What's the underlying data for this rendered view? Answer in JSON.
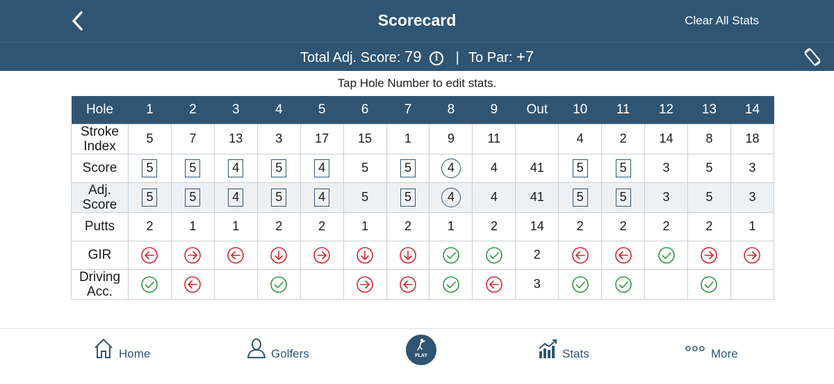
{
  "header": {
    "title": "Scorecard",
    "clear_label": "Clear All Stats"
  },
  "total": {
    "adj_label": "Total Adj. Score:",
    "adj_value": "79",
    "info_glyph": "i",
    "separator": "|",
    "par_label": "To Par:",
    "par_value": "+7"
  },
  "hint": "Tap Hole Number to edit stats.",
  "table": {
    "columns": [
      "Hole",
      "1",
      "2",
      "3",
      "4",
      "5",
      "6",
      "7",
      "8",
      "9",
      "Out",
      "10",
      "11",
      "12",
      "13",
      "14"
    ],
    "rows": [
      {
        "label": "Stroke Index",
        "cells": [
          {
            "v": "5"
          },
          {
            "v": "7"
          },
          {
            "v": "13"
          },
          {
            "v": "3"
          },
          {
            "v": "17"
          },
          {
            "v": "15"
          },
          {
            "v": "1"
          },
          {
            "v": "9"
          },
          {
            "v": "11"
          },
          {
            "v": ""
          },
          {
            "v": "4"
          },
          {
            "v": "2"
          },
          {
            "v": "14"
          },
          {
            "v": "8"
          },
          {
            "v": "18"
          }
        ]
      },
      {
        "label": "Score",
        "cells": [
          {
            "v": "5",
            "mark": "square"
          },
          {
            "v": "5",
            "mark": "square"
          },
          {
            "v": "4",
            "mark": "square"
          },
          {
            "v": "5",
            "mark": "square"
          },
          {
            "v": "4",
            "mark": "square"
          },
          {
            "v": "5"
          },
          {
            "v": "5",
            "mark": "square"
          },
          {
            "v": "4",
            "mark": "circle"
          },
          {
            "v": "4"
          },
          {
            "v": "41"
          },
          {
            "v": "5",
            "mark": "square"
          },
          {
            "v": "5",
            "mark": "square"
          },
          {
            "v": "3"
          },
          {
            "v": "5"
          },
          {
            "v": "3"
          }
        ]
      },
      {
        "label": "Adj. Score",
        "shade": true,
        "cells": [
          {
            "v": "5",
            "mark": "square"
          },
          {
            "v": "5",
            "mark": "square"
          },
          {
            "v": "4",
            "mark": "square"
          },
          {
            "v": "5",
            "mark": "square"
          },
          {
            "v": "4",
            "mark": "square"
          },
          {
            "v": "5"
          },
          {
            "v": "5",
            "mark": "square"
          },
          {
            "v": "4",
            "mark": "circle"
          },
          {
            "v": "4"
          },
          {
            "v": "41"
          },
          {
            "v": "5",
            "mark": "square"
          },
          {
            "v": "5",
            "mark": "square"
          },
          {
            "v": "3"
          },
          {
            "v": "5"
          },
          {
            "v": "3"
          }
        ]
      },
      {
        "label": "Putts",
        "cells": [
          {
            "v": "2"
          },
          {
            "v": "1"
          },
          {
            "v": "1"
          },
          {
            "v": "2"
          },
          {
            "v": "2"
          },
          {
            "v": "1"
          },
          {
            "v": "2"
          },
          {
            "v": "1"
          },
          {
            "v": "2"
          },
          {
            "v": "14"
          },
          {
            "v": "2"
          },
          {
            "v": "2"
          },
          {
            "v": "2"
          },
          {
            "v": "2"
          },
          {
            "v": "1"
          }
        ]
      },
      {
        "label": "GIR",
        "cells": [
          {
            "icon": "arrow-left-icon"
          },
          {
            "icon": "arrow-right-icon"
          },
          {
            "icon": "arrow-left-icon"
          },
          {
            "icon": "arrow-down-icon"
          },
          {
            "icon": "arrow-right-icon"
          },
          {
            "icon": "arrow-down-icon"
          },
          {
            "icon": "arrow-down-icon"
          },
          {
            "icon": "check-icon"
          },
          {
            "icon": "check-icon"
          },
          {
            "v": "2"
          },
          {
            "icon": "arrow-left-icon"
          },
          {
            "icon": "arrow-left-icon"
          },
          {
            "icon": "check-icon"
          },
          {
            "icon": "arrow-right-icon"
          },
          {
            "icon": "arrow-right-icon"
          }
        ]
      },
      {
        "label": "Driving Acc.",
        "cells": [
          {
            "icon": "check-icon"
          },
          {
            "icon": "arrow-left-icon"
          },
          {
            "v": ""
          },
          {
            "icon": "check-icon"
          },
          {
            "v": ""
          },
          {
            "icon": "arrow-right-icon"
          },
          {
            "icon": "arrow-left-icon"
          },
          {
            "icon": "check-icon"
          },
          {
            "icon": "arrow-left-icon"
          },
          {
            "v": "3"
          },
          {
            "icon": "check-icon"
          },
          {
            "icon": "check-icon"
          },
          {
            "v": ""
          },
          {
            "icon": "check-icon"
          },
          {
            "v": ""
          }
        ]
      }
    ]
  },
  "nav": {
    "home": "Home",
    "golfers": "Golfers",
    "play": "PLAY",
    "stats": "Stats",
    "more": "More"
  },
  "colors": {
    "brand": "#2f5573",
    "miss": "#d9262c",
    "hit": "#2e9a3e"
  },
  "icons": {
    "back": "chevron-left-icon",
    "info": "info-icon",
    "rotate": "rotate-screen-icon",
    "home": "house-icon",
    "golfers": "person-icon",
    "play": "golfer-icon",
    "stats": "bar-chart-icon",
    "more": "ellipsis-icon"
  }
}
